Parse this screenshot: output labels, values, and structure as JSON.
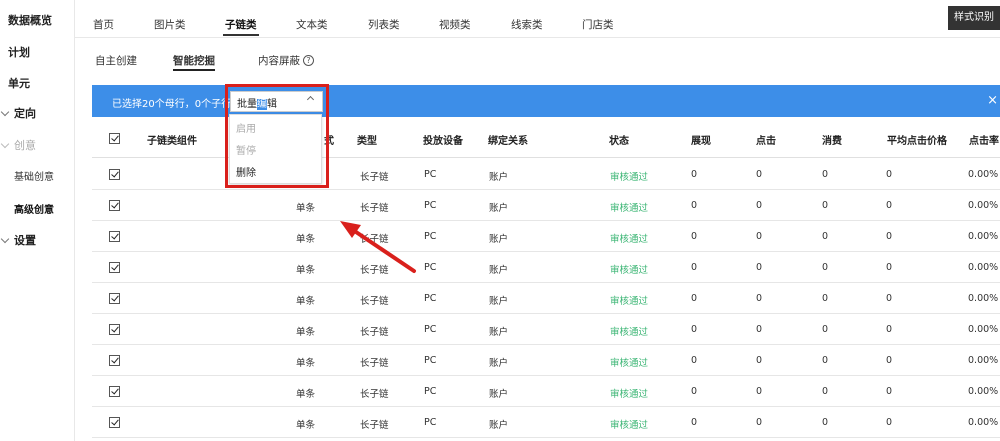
{
  "sidebar": {
    "items": [
      {
        "label": "数据概览"
      },
      {
        "label": "计划"
      },
      {
        "label": "单元"
      },
      {
        "label": "定向"
      },
      {
        "label": "创意"
      },
      {
        "label": "设置"
      }
    ],
    "sub_items": [
      {
        "label": "基础创意"
      },
      {
        "label": "高级创意"
      }
    ]
  },
  "top_tabs": [
    {
      "label": "首页"
    },
    {
      "label": "图片类"
    },
    {
      "label": "子链类"
    },
    {
      "label": "文本类"
    },
    {
      "label": "列表类"
    },
    {
      "label": "视频类"
    },
    {
      "label": "线索类"
    },
    {
      "label": "门店类"
    }
  ],
  "style_button": "样式识别",
  "sub_tabs": [
    {
      "label": "自主创建"
    },
    {
      "label": "智能挖掘"
    },
    {
      "label": "内容屏蔽"
    }
  ],
  "help_icon": "?",
  "selection_bar": {
    "text": "已选择20个母行，0个子行",
    "batch_prefix": "批量",
    "batch_highlight": "编",
    "batch_suffix": "辑",
    "close": "×"
  },
  "dropdown": {
    "items": [
      {
        "label": "启用"
      },
      {
        "label": "暂停"
      },
      {
        "label": "删除"
      }
    ]
  },
  "table": {
    "headers": {
      "component": "子链类组件",
      "format": "式",
      "type": "类型",
      "device": "投放设备",
      "binding": "绑定关系",
      "status": "状态",
      "impressions": "展现",
      "clicks": "点击",
      "cost": "消费",
      "avg_cpc": "平均点击价格",
      "ctr": "点击率"
    },
    "rows": [
      {
        "format": "",
        "type": "长子链",
        "device": "PC",
        "binding": "账户",
        "status": "审核通过",
        "impressions": "0",
        "clicks": "0",
        "cost": "0",
        "avg_cpc": "0",
        "ctr": "0.00%"
      },
      {
        "format": "单条",
        "type": "长子链",
        "device": "PC",
        "binding": "账户",
        "status": "审核通过",
        "impressions": "0",
        "clicks": "0",
        "cost": "0",
        "avg_cpc": "0",
        "ctr": "0.00%"
      },
      {
        "format": "单条",
        "type": "长子链",
        "device": "PC",
        "binding": "账户",
        "status": "审核通过",
        "impressions": "0",
        "clicks": "0",
        "cost": "0",
        "avg_cpc": "0",
        "ctr": "0.00%"
      },
      {
        "format": "单条",
        "type": "长子链",
        "device": "PC",
        "binding": "账户",
        "status": "审核通过",
        "impressions": "0",
        "clicks": "0",
        "cost": "0",
        "avg_cpc": "0",
        "ctr": "0.00%"
      },
      {
        "format": "单条",
        "type": "长子链",
        "device": "PC",
        "binding": "账户",
        "status": "审核通过",
        "impressions": "0",
        "clicks": "0",
        "cost": "0",
        "avg_cpc": "0",
        "ctr": "0.00%"
      },
      {
        "format": "单条",
        "type": "长子链",
        "device": "PC",
        "binding": "账户",
        "status": "审核通过",
        "impressions": "0",
        "clicks": "0",
        "cost": "0",
        "avg_cpc": "0",
        "ctr": "0.00%"
      },
      {
        "format": "单条",
        "type": "长子链",
        "device": "PC",
        "binding": "账户",
        "status": "审核通过",
        "impressions": "0",
        "clicks": "0",
        "cost": "0",
        "avg_cpc": "0",
        "ctr": "0.00%"
      },
      {
        "format": "单条",
        "type": "长子链",
        "device": "PC",
        "binding": "账户",
        "status": "审核通过",
        "impressions": "0",
        "clicks": "0",
        "cost": "0",
        "avg_cpc": "0",
        "ctr": "0.00%"
      },
      {
        "format": "单条",
        "type": "长子链",
        "device": "PC",
        "binding": "账户",
        "status": "审核通过",
        "impressions": "0",
        "clicks": "0",
        "cost": "0",
        "avg_cpc": "0",
        "ctr": "0.00%"
      }
    ]
  },
  "colors": {
    "accent_blue": "#3d8ee8",
    "status_green": "#3bb574",
    "highlight_red": "#d9201c"
  }
}
